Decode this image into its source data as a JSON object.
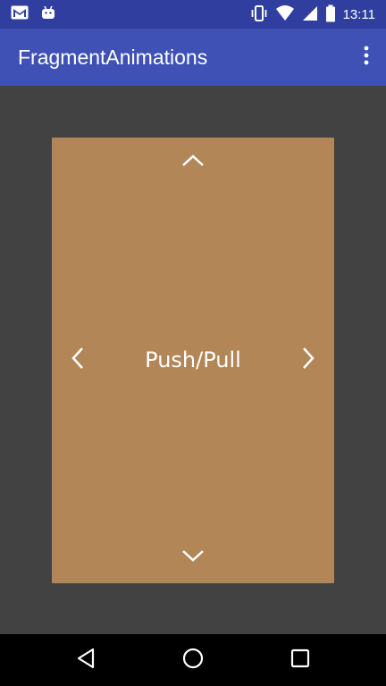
{
  "status_bar": {
    "time": "13:11",
    "left_icons": [
      "gmail-icon",
      "android-icon"
    ],
    "right_icons": [
      "vibrate-icon",
      "wifi-icon",
      "signal-icon",
      "battery-icon"
    ]
  },
  "app_bar": {
    "title": "FragmentAnimations",
    "overflow_icon": "more-vert-icon"
  },
  "card": {
    "label": "Push/Pull",
    "arrows": [
      "chevron-up-icon",
      "chevron-left-icon",
      "chevron-right-icon",
      "chevron-down-icon"
    ]
  },
  "nav_bar": {
    "buttons": [
      "back-icon",
      "home-icon",
      "recents-icon"
    ]
  },
  "colors": {
    "status_bar": "#303f9f",
    "app_bar": "#3f51b5",
    "background": "#424242",
    "card": "#b38658",
    "card_text": "#ffffff",
    "nav_bar": "#000000"
  }
}
